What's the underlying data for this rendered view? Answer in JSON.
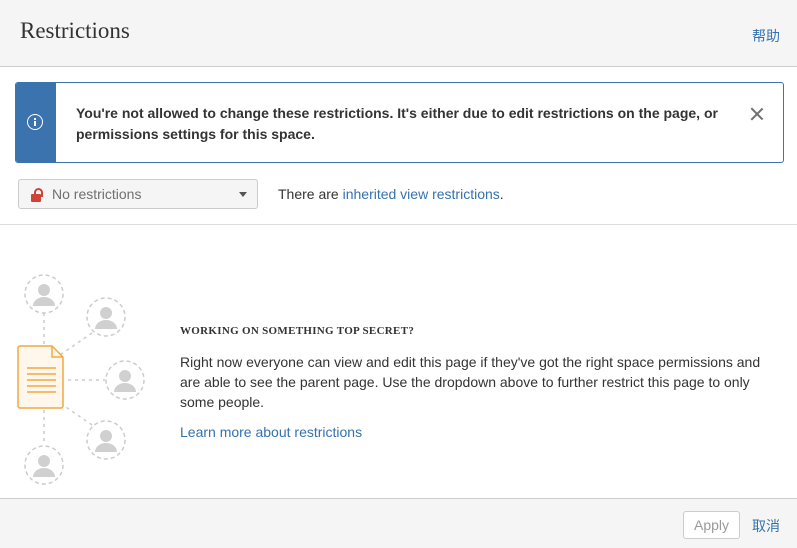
{
  "dialog": {
    "title": "Restrictions",
    "help_label": "帮助"
  },
  "banner": {
    "message": "You're not allowed to change these restrictions. It's either due to edit restrictions on the page, or permissions settings for this space.",
    "icon": "info-icon",
    "accent_color": "#3b73af"
  },
  "restrictions": {
    "selected": "No restrictions",
    "inherited_prefix": "There are ",
    "inherited_link": "inherited view restrictions",
    "inherited_suffix": ".",
    "lock_color": "#d04437"
  },
  "empty_state": {
    "heading": "WORKING ON SOMETHING TOP SECRET?",
    "description": "Right now everyone can view and edit this page if they've got the right space permissions and are able to see the parent page. Use the dropdown above to further restrict this page to only some people.",
    "learn_more": "Learn more about restrictions"
  },
  "footer": {
    "apply_label": "Apply",
    "cancel_label": "取消"
  }
}
